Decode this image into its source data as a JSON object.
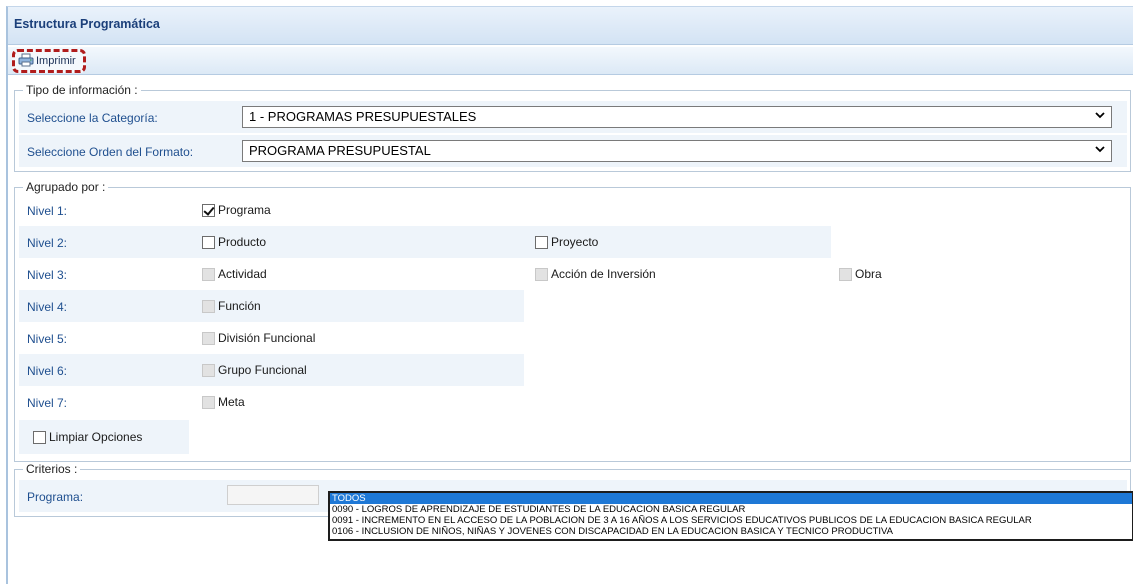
{
  "window": {
    "title": "Estructura Programática"
  },
  "toolbar": {
    "print_label": "Imprimir"
  },
  "tipo": {
    "legend": "Tipo de información :",
    "categoria_label": "Seleccione la Categoría:",
    "categoria_value": "1 - PROGRAMAS PRESUPUESTALES",
    "orden_label": "Seleccione Orden del Formato:",
    "orden_value": "PROGRAMA PRESUPUESTAL"
  },
  "agrupado": {
    "legend": "Agrupado por :",
    "levels": [
      {
        "label": "Nivel 1:",
        "options": [
          {
            "text": "Programa",
            "checked": true,
            "disabled": false
          }
        ]
      },
      {
        "label": "Nivel 2:",
        "options": [
          {
            "text": "Producto",
            "checked": false,
            "disabled": false
          },
          {
            "text": "Proyecto",
            "checked": false,
            "disabled": false
          }
        ]
      },
      {
        "label": "Nivel 3:",
        "options": [
          {
            "text": "Actividad",
            "checked": false,
            "disabled": true
          },
          {
            "text": "Acción de Inversión",
            "checked": false,
            "disabled": true
          },
          {
            "text": "Obra",
            "checked": false,
            "disabled": true
          }
        ]
      },
      {
        "label": "Nivel 4:",
        "options": [
          {
            "text": "Función",
            "checked": false,
            "disabled": true
          }
        ]
      },
      {
        "label": "Nivel 5:",
        "options": [
          {
            "text": "División Funcional",
            "checked": false,
            "disabled": true
          }
        ]
      },
      {
        "label": "Nivel 6:",
        "options": [
          {
            "text": "Grupo Funcional",
            "checked": false,
            "disabled": true
          }
        ]
      },
      {
        "label": "Nivel 7:",
        "options": [
          {
            "text": "Meta",
            "checked": false,
            "disabled": true
          }
        ]
      }
    ],
    "clear_label": "Limpiar Opciones"
  },
  "criterios": {
    "legend": "Criterios :",
    "programa_label": "Programa:",
    "programa_options": [
      "TODOS",
      "0090 - LOGROS DE APRENDIZAJE DE ESTUDIANTES DE LA EDUCACION BASICA REGULAR",
      "0091 - INCREMENTO EN EL ACCESO DE LA POBLACION DE 3 A 16 AÑOS A LOS SERVICIOS EDUCATIVOS PUBLICOS DE LA EDUCACION BASICA REGULAR",
      "0106 - INCLUSION DE NIÑOS, NIÑAS Y JOVENES CON DISCAPACIDAD EN LA EDUCACION BASICA Y TECNICO PRODUCTIVA"
    ]
  }
}
